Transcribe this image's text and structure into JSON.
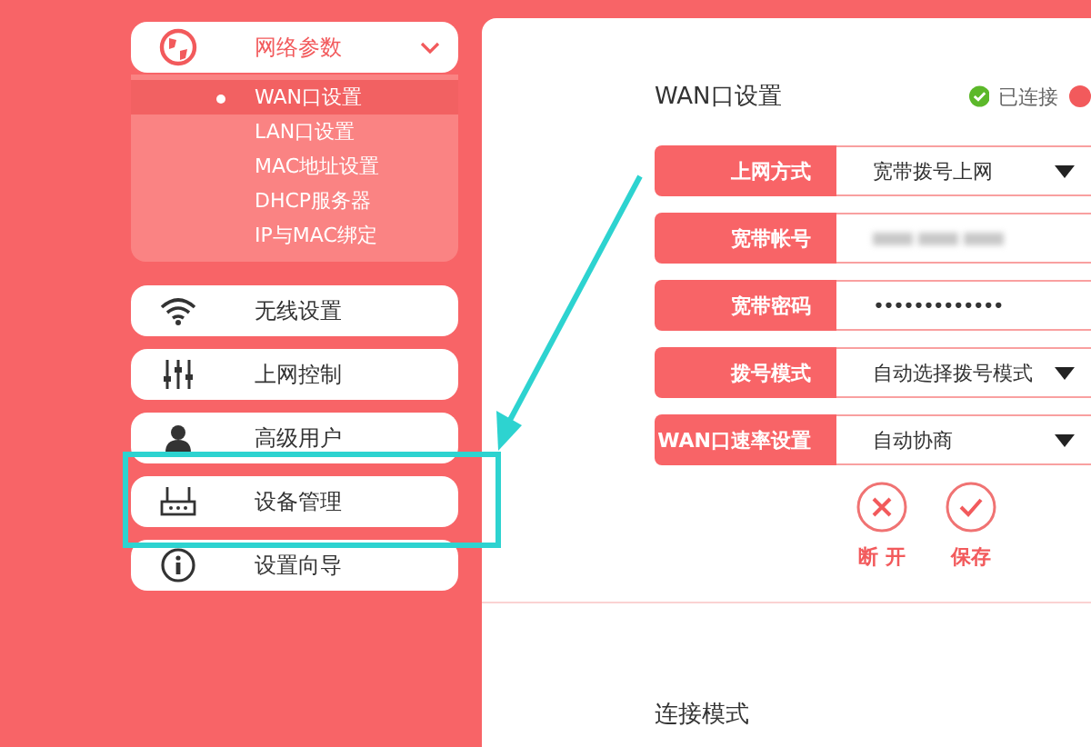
{
  "sidebar": {
    "groups": [
      {
        "label": "网络参数",
        "kind": "globe",
        "expanded": true,
        "children": [
          {
            "label": "WAN口设置",
            "selected": true
          },
          {
            "label": "LAN口设置",
            "selected": false
          },
          {
            "label": "MAC地址设置",
            "selected": false
          },
          {
            "label": "DHCP服务器",
            "selected": false
          },
          {
            "label": "IP与MAC绑定",
            "selected": false
          }
        ]
      },
      {
        "label": "无线设置",
        "kind": "wifi",
        "expanded": false
      },
      {
        "label": "上网控制",
        "kind": "sliders",
        "expanded": false
      },
      {
        "label": "高级用户",
        "kind": "user",
        "expanded": false
      },
      {
        "label": "设备管理",
        "kind": "router",
        "expanded": false
      },
      {
        "label": "设置向导",
        "kind": "info",
        "expanded": false
      }
    ]
  },
  "main": {
    "title": "WAN口设置",
    "status": {
      "label": "已连接",
      "connected": true
    },
    "form": [
      {
        "label": "上网方式",
        "kind": "select",
        "value": "宽带拨号上网"
      },
      {
        "label": "宽带帐号",
        "kind": "redacted"
      },
      {
        "label": "宽带密码",
        "kind": "password",
        "value": "•••••••••••••"
      },
      {
        "label": "拨号模式",
        "kind": "select",
        "value": "自动选择拨号模式"
      },
      {
        "label": "WAN口速率设置",
        "kind": "select",
        "value": "自动协商"
      }
    ],
    "actions": [
      {
        "label": "断 开",
        "kind": "cancel"
      },
      {
        "label": "保存",
        "kind": "confirm"
      }
    ],
    "next_section": "连接模式"
  }
}
